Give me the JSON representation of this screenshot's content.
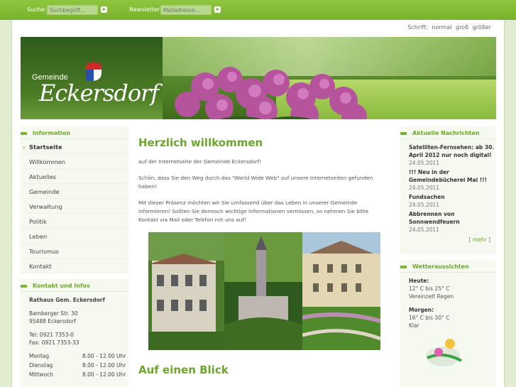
{
  "topbar": {
    "search_label": "Suche:",
    "search_placeholder": "Suchbegriff...",
    "newsletter_label": "Newsletter:",
    "newsletter_placeholder": "Mailadresse..."
  },
  "fontsize": {
    "label": "Schrift:",
    "normal": "normal",
    "gross": "groß",
    "groesser": "größer"
  },
  "logo": {
    "line1": "Gemeinde",
    "line2": "Eckersdorf"
  },
  "left": {
    "info_heading": "Information",
    "nav": [
      "Startseite",
      "Willkommen",
      "Aktuelles",
      "Gemeinde",
      "Verwaltung",
      "Politik",
      "Leben",
      "Tourismus",
      "Kontakt"
    ],
    "contact_heading": "Kontakt und Infos",
    "rathaus": "Rathaus Gem. Eckersdorf",
    "street": "Bamberger Str. 30",
    "city": "95488 Eckersdorf",
    "tel": "Tel: 0921 7353-0",
    "fax": "Fax: 0921 7353-33",
    "hours": [
      {
        "day": "Montag",
        "time": "8.00 - 12.00 Uhr"
      },
      {
        "day": "Dienstag",
        "time": "8.00 - 12.00 Uhr"
      },
      {
        "day": "Mittwoch",
        "time": "8.00 - 12.00 Uhr"
      }
    ]
  },
  "main": {
    "title": "Herzlich willkommen",
    "p1": "auf der Internetseite der Gemeinde Eckersdorf!",
    "p2": "Schön, dass Sie den Weg durch das \"World Wide Web\" auf unsere Internetseiten gefunden haben!",
    "p3": "Mit dieser Präsenz möchten wir Sie umfassend über das Leben in unserer Gemeinde informieren! Sollten Sie dennoch wichtige Informationen vermissen, so nehmen Sie bitte Kontakt via Mail oder Telefon mit uns auf!",
    "section2": "Auf einen Blick"
  },
  "right": {
    "news_heading": "Aktuelle Nachrichten",
    "news": [
      {
        "title": "Satelliten-Fernsehen: ab 30. April 2012 nur noch digital!",
        "date": "24.05.2011"
      },
      {
        "title": "!!! Neu in der Gemeindebücherei Mai !!!",
        "date": "24.05.2011"
      },
      {
        "title": "Fundsachen",
        "date": "24.05.2011"
      },
      {
        "title": "Abbrennen von Sonnwendfeuern",
        "date": "24.05.2011"
      }
    ],
    "more_open": "[",
    "more": "mehr",
    "more_close": "]",
    "weather_heading": "Wetteraussichten",
    "weather": [
      {
        "label": "Heute:",
        "temp": "12° C bis 25° C",
        "desc": "Vereinzelt Regen"
      },
      {
        "label": "Morgen:",
        "temp": "16° C bis 30° C",
        "desc": "Klar"
      }
    ]
  },
  "colors": {
    "accent": "#79b52f",
    "heading": "#6aa72a"
  }
}
